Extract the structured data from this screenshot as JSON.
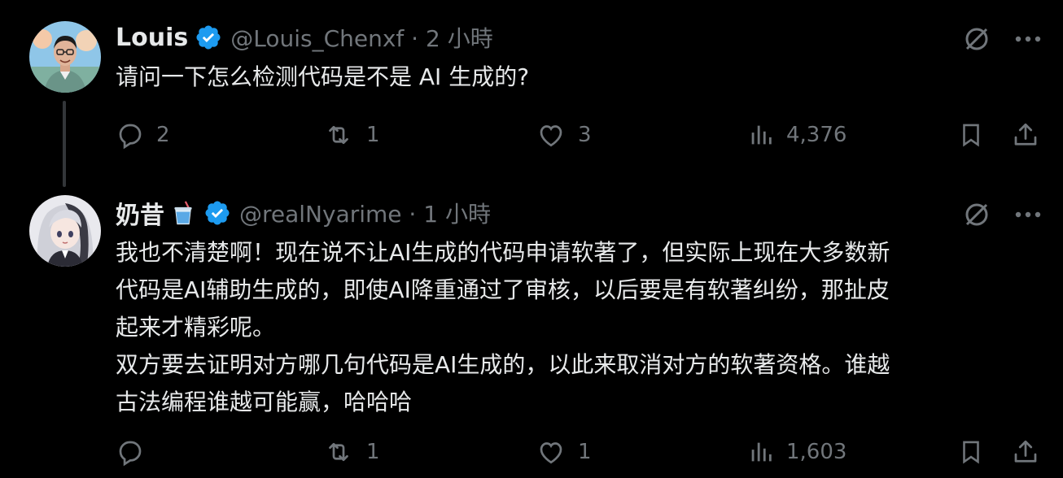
{
  "tweets": [
    {
      "name": "Louis",
      "handle": "@Louis_Chenxf · 2 小時",
      "text": "请问一下怎么检测代码是不是 AI 生成的?",
      "replies": "2",
      "reposts": "1",
      "likes": "3",
      "views": "4,376"
    },
    {
      "name": "奶昔",
      "handle": "@realNyarime · 1 小時",
      "text": "我也不清楚啊！现在说不让AI生成的代码申请软著了，但实际上现在大多数新\n代码是AI辅助生成的，即使AI降重通过了审核，以后要是有软著纠纷，那扯皮\n起来才精彩呢。\n双方要去证明对方哪几句代码是AI生成的，以此来取消对方的软著资格。谁越\n古法编程谁越可能赢，哈哈哈",
      "replies": "",
      "reposts": "1",
      "likes": "1",
      "views": "1,603"
    }
  ],
  "icons": {
    "verified": "verified-badge-icon",
    "emoji": "milkshake-emoji",
    "grok": "grok-icon",
    "more": "more-icon",
    "reply": "reply-icon",
    "repost": "repost-icon",
    "like": "like-icon",
    "views": "views-icon",
    "bookmark": "bookmark-icon",
    "share": "share-icon"
  },
  "colors": {
    "background": "#000000",
    "text": "#e7e9ea",
    "secondary": "#71767b",
    "verified": "#1d9bf0"
  }
}
